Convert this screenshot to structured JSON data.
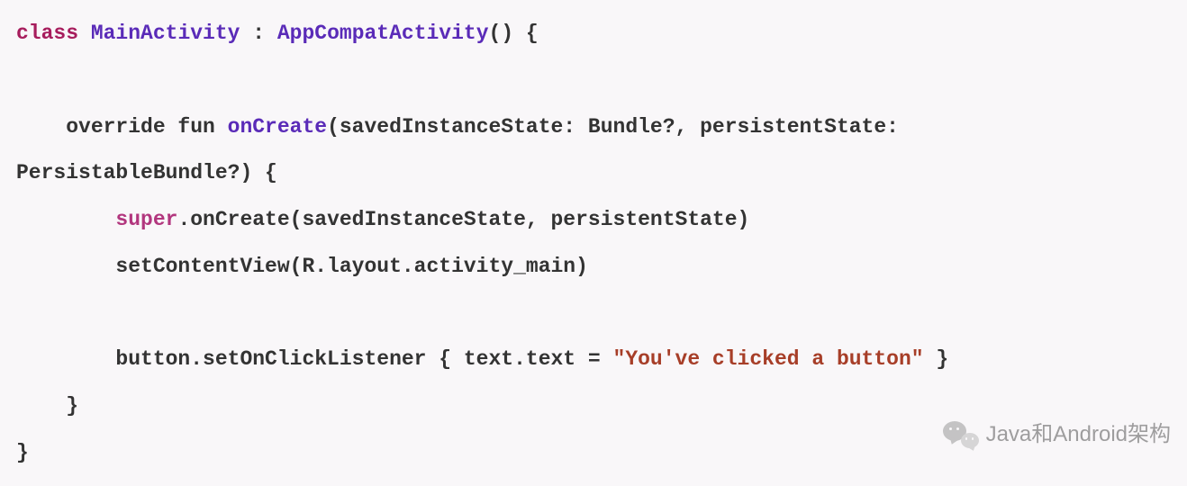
{
  "code": {
    "l1": {
      "kw_class": "class",
      "name": "MainActivity ",
      "colon": ": ",
      "super": "AppCompatActivity",
      "tail": "() {"
    },
    "l2": {
      "pre": "    override fun ",
      "fn": "onCreate",
      "args": "(savedInstanceState: Bundle?, persistentState: "
    },
    "l3": {
      "text": "PersistableBundle?) {"
    },
    "l4": {
      "indent": "        ",
      "sup": "super",
      "tail": ".onCreate(savedInstanceState, persistentState)"
    },
    "l5": {
      "text": "        setContentView(R.layout.activity_main)"
    },
    "l6": {
      "pre": "        button.setOnClickListener { text.text = ",
      "str": "\"You've clicked a button\"",
      "tail": " }"
    },
    "l7": {
      "text": "    }"
    },
    "l8": {
      "text": "}"
    }
  },
  "watermark": {
    "label": "Java和Android架构"
  }
}
